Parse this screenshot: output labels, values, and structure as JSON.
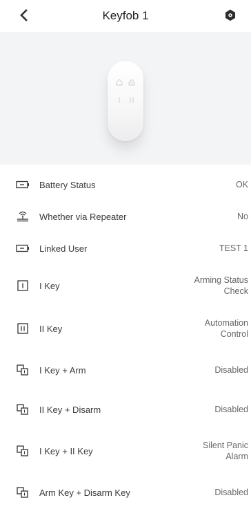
{
  "header": {
    "title": "Keyfob 1"
  },
  "rows": [
    {
      "label": "Battery Status",
      "value": "OK",
      "icon": "battery-icon"
    },
    {
      "label": "Whether via Repeater",
      "value": "No",
      "icon": "repeater-icon"
    },
    {
      "label": "Linked User",
      "value": "TEST 1",
      "icon": "battery-icon"
    },
    {
      "label": "I Key",
      "value": "Arming Status Check",
      "icon": "key-i-icon"
    },
    {
      "label": "II Key",
      "value": "Automation Control",
      "icon": "key-ii-icon"
    },
    {
      "label": "I Key + Arm",
      "value": "Disabled",
      "icon": "combo-keys-icon"
    },
    {
      "label": "II Key + Disarm",
      "value": "Disabled",
      "icon": "combo-keys-icon"
    },
    {
      "label": "I Key + II Key",
      "value": "Silent Panic Alarm",
      "icon": "combo-keys-icon"
    },
    {
      "label": "Arm Key + Disarm Key",
      "value": "Disabled",
      "icon": "combo-keys-icon"
    }
  ]
}
